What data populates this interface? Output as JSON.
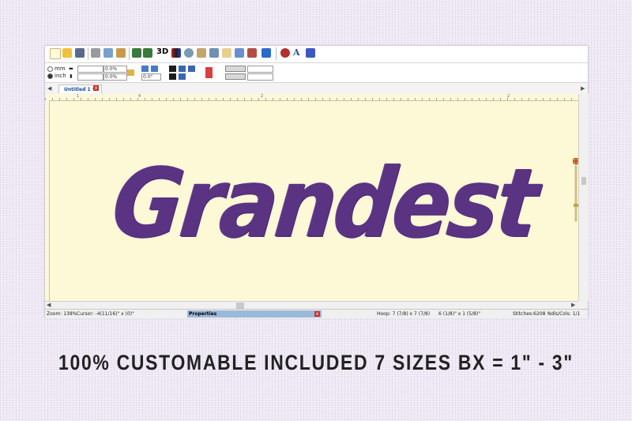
{
  "toolbar": {
    "icons": [
      "new-icon",
      "open-icon",
      "save-icon",
      "print-icon",
      "copy-icon",
      "paste-icon",
      "undo-icon",
      "redo-icon",
      "3d-icon",
      "color-icon",
      "zoom-icon",
      "measure-icon",
      "move-icon",
      "select-icon",
      "hoop-icon",
      "needle-icon",
      "grid-icon",
      "stitch-icon",
      "text-icon",
      "export-icon"
    ],
    "label_3d": "3D"
  },
  "units": {
    "mm_label": "mm",
    "inch_label": "inch",
    "selected": "inch",
    "field1": "",
    "field2": "",
    "pct1": "0.0%",
    "pct2": "0.0%",
    "angle": "0.0°"
  },
  "document": {
    "tab_label": "Untitled 1 *",
    "tab_close": "x",
    "design_text": "Grandest",
    "thread_color": "#5b3383",
    "ruler": {
      "marks": [
        "1",
        "4",
        "2",
        "2"
      ]
    }
  },
  "status": {
    "zoom": "Zoom: 138%",
    "cursor": "Cursor: -4(11/16)\" x (0)\"",
    "panel_title": "Properties",
    "panel_close": "x",
    "hoop": "Hoop: 7 (7/8) x 7 (7/8)",
    "size": "6 (1/8)\" x 1 (5/8)\"",
    "stitches": "Stitches:6208",
    "ndls": "Ndls/Cols: 1/1"
  },
  "caption": "100% CUSTOMABLE INCLUDED 7 SIZES BX = 1\" -  3\""
}
